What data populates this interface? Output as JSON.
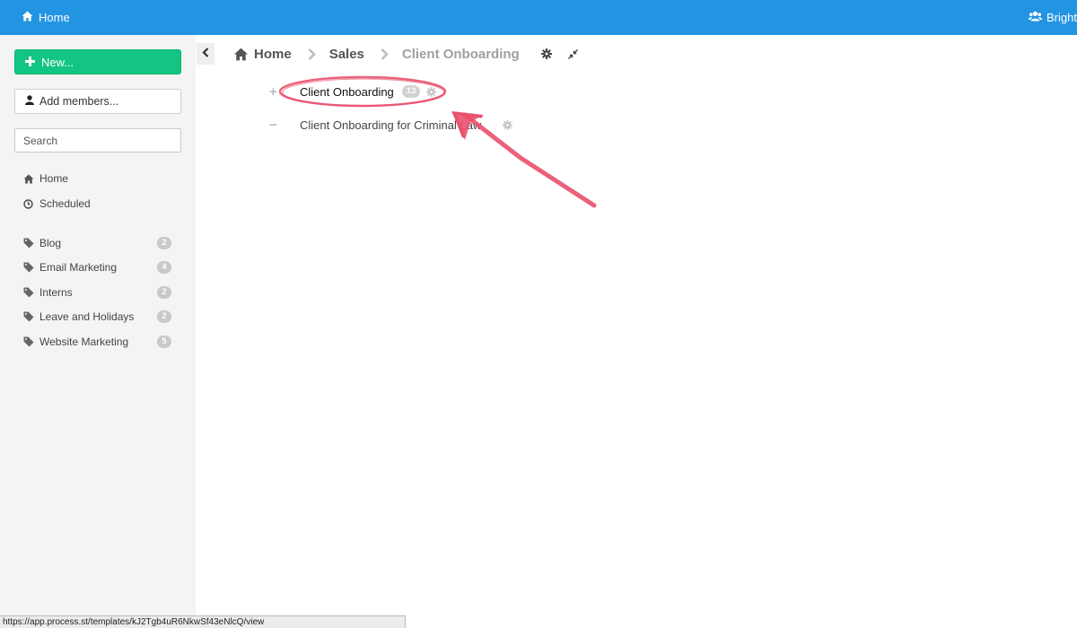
{
  "topbar": {
    "home_label": "Home",
    "org_label": "Bright S",
    "background": "#2394e2"
  },
  "sidebar": {
    "new_button": "New...",
    "add_members_button": "Add members...",
    "search_placeholder": "Search",
    "nav": [
      {
        "label": "Home",
        "icon": "home-icon"
      },
      {
        "label": "Scheduled",
        "icon": "clock-icon"
      }
    ],
    "tags": [
      {
        "label": "Blog",
        "count": "2"
      },
      {
        "label": "Email Marketing",
        "count": "4"
      },
      {
        "label": "Interns",
        "count": "2"
      },
      {
        "label": "Leave and Holidays",
        "count": "2"
      },
      {
        "label": "Website Marketing",
        "count": "5"
      }
    ],
    "accent": "#13c582"
  },
  "breadcrumb": {
    "items": [
      "Home",
      "Sales",
      "Client Onboarding"
    ]
  },
  "rows": [
    {
      "toggle": "+",
      "title": "Client Onboarding",
      "count": "13"
    },
    {
      "toggle": "−",
      "title": "Client Onboarding for Criminal Law"
    }
  ],
  "status_url": "https://app.process.st/templates/kJ2Tgb4uR6NkwSf43eNlcQ/view",
  "annotation_color": "#e94f6b"
}
